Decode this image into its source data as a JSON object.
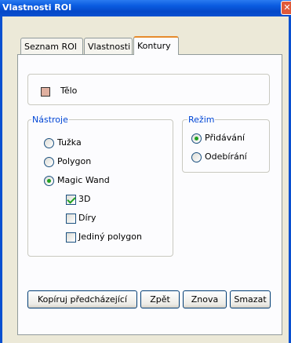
{
  "window": {
    "title": "Vlastnosti ROI"
  },
  "tabs": [
    {
      "label": "Seznam ROI",
      "active": false
    },
    {
      "label": "Vlastnosti",
      "active": false
    },
    {
      "label": "Kontury",
      "active": true
    }
  ],
  "roi": {
    "name": "Tělo",
    "color": "#e0b0a0"
  },
  "tools": {
    "title": "Nástroje",
    "options": [
      {
        "label": "Tužka",
        "selected": false
      },
      {
        "label": "Polygon",
        "selected": false
      },
      {
        "label": "Magic Wand",
        "selected": true
      }
    ],
    "magic_wand_options": [
      {
        "label": "3D",
        "checked": true
      },
      {
        "label": "Díry",
        "checked": false
      },
      {
        "label": "Jediný polygon",
        "checked": false
      }
    ]
  },
  "mode": {
    "title": "Režim",
    "options": [
      {
        "label": "Přidávání",
        "selected": true
      },
      {
        "label": "Odebírání",
        "selected": false
      }
    ]
  },
  "buttons": {
    "copy_previous": "Kopíruj předcházející",
    "back": "Zpět",
    "again": "Znova",
    "delete": "Smazat"
  }
}
